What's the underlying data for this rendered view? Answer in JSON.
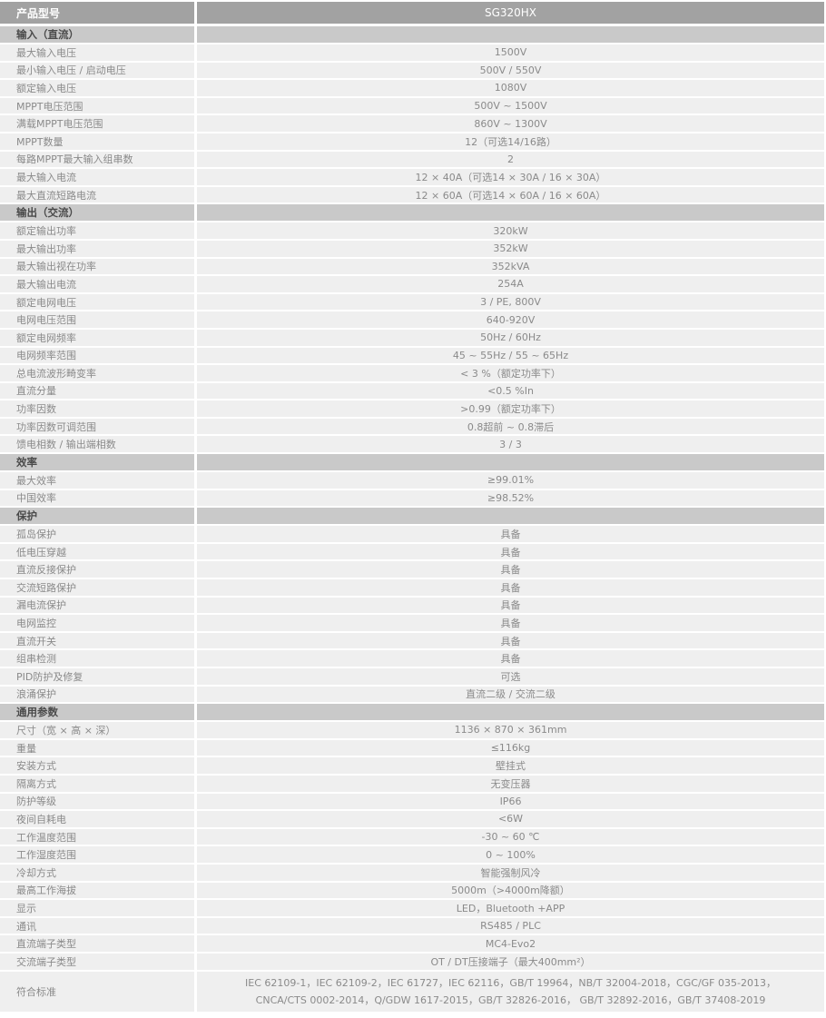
{
  "header": {
    "label": "产品型号",
    "model": "SG320HX"
  },
  "sections": [
    {
      "title": "输入（直流）",
      "rows": [
        {
          "k": "最大输入电压",
          "v": "1500V"
        },
        {
          "k": "最小输入电压 / 启动电压",
          "v": "500V / 550V"
        },
        {
          "k": "额定输入电压",
          "v": "1080V"
        },
        {
          "k": "MPPT电压范围",
          "v": "500V ~ 1500V"
        },
        {
          "k": "满载MPPT电压范围",
          "v": "860V ~ 1300V"
        },
        {
          "k": "MPPT数量",
          "v": "12（可选14/16路）"
        },
        {
          "k": "每路MPPT最大输入组串数",
          "v": "2"
        },
        {
          "k": "最大输入电流",
          "v": "12 × 40A（可选14 × 30A / 16 × 30A）"
        },
        {
          "k": "最大直流短路电流",
          "v": "12 × 60A（可选14 × 60A / 16 × 60A）"
        }
      ]
    },
    {
      "title": "输出（交流）",
      "rows": [
        {
          "k": "额定输出功率",
          "v": "320kW"
        },
        {
          "k": "最大输出功率",
          "v": "352kW"
        },
        {
          "k": "最大输出视在功率",
          "v": "352kVA"
        },
        {
          "k": "最大输出电流",
          "v": "254A"
        },
        {
          "k": "额定电网电压",
          "v": "3 / PE, 800V"
        },
        {
          "k": "电网电压范围",
          "v": "640-920V"
        },
        {
          "k": "额定电网频率",
          "v": "50Hz / 60Hz"
        },
        {
          "k": "电网频率范围",
          "v": "45 ~ 55Hz / 55 ~ 65Hz"
        },
        {
          "k": "总电流波形畸变率",
          "v": "< 3 %（额定功率下）"
        },
        {
          "k": "直流分量",
          "v": "<0.5 %In"
        },
        {
          "k": "功率因数",
          "v": ">0.99（额定功率下）"
        },
        {
          "k": "功率因数可调范围",
          "v": "0.8超前 ~ 0.8滞后"
        },
        {
          "k": "馈电相数 / 输出端相数",
          "v": "3 / 3"
        }
      ]
    },
    {
      "title": "效率",
      "rows": [
        {
          "k": "最大效率",
          "v": "≥99.01%"
        },
        {
          "k": "中国效率",
          "v": "≥98.52%"
        }
      ]
    },
    {
      "title": "保护",
      "rows": [
        {
          "k": "孤岛保护",
          "v": "具备"
        },
        {
          "k": "低电压穿越",
          "v": "具备"
        },
        {
          "k": "直流反接保护",
          "v": "具备"
        },
        {
          "k": "交流短路保护",
          "v": "具备"
        },
        {
          "k": "漏电流保护",
          "v": "具备"
        },
        {
          "k": "电网监控",
          "v": "具备"
        },
        {
          "k": "直流开关",
          "v": "具备"
        },
        {
          "k": "组串检测",
          "v": "具备"
        },
        {
          "k": "PID防护及修复",
          "v": "可选"
        },
        {
          "k": "浪涌保护",
          "v": "直流二级 / 交流二级"
        }
      ]
    },
    {
      "title": "通用参数",
      "rows": [
        {
          "k": "尺寸（宽 × 高 × 深）",
          "v": "1136 × 870 × 361mm"
        },
        {
          "k": "重量",
          "v": "≤116kg"
        },
        {
          "k": "安装方式",
          "v": "壁挂式"
        },
        {
          "k": "隔离方式",
          "v": "无变压器"
        },
        {
          "k": "防护等级",
          "v": "IP66"
        },
        {
          "k": "夜间自耗电",
          "v": "<6W"
        },
        {
          "k": "工作温度范围",
          "v": "-30 ~ 60 ℃"
        },
        {
          "k": "工作湿度范围",
          "v": "0 ~ 100%"
        },
        {
          "k": "冷却方式",
          "v": "智能强制风冷"
        },
        {
          "k": "最高工作海拔",
          "v": "5000m（>4000m降额）"
        },
        {
          "k": "显示",
          "v": "LED，Bluetooth +APP"
        },
        {
          "k": "通讯",
          "v": "RS485 / PLC"
        },
        {
          "k": "直流端子类型",
          "v": "MC4-Evo2"
        },
        {
          "k": "交流端子类型",
          "v": "OT / DT压接端子（最大400mm²）"
        }
      ]
    }
  ],
  "standards": {
    "k": "符合标准",
    "line1": "IEC 62109-1，IEC 62109-2，IEC 61727，IEC 62116，GB/T 19964，NB/T 32004-2018，CGC/GF 035-2013，",
    "line2": "CNCA/CTS 0002-2014，Q/GDW 1617-2015，GB/T 32826-2016， GB/T 32892-2016，GB/T 37408-2019"
  }
}
